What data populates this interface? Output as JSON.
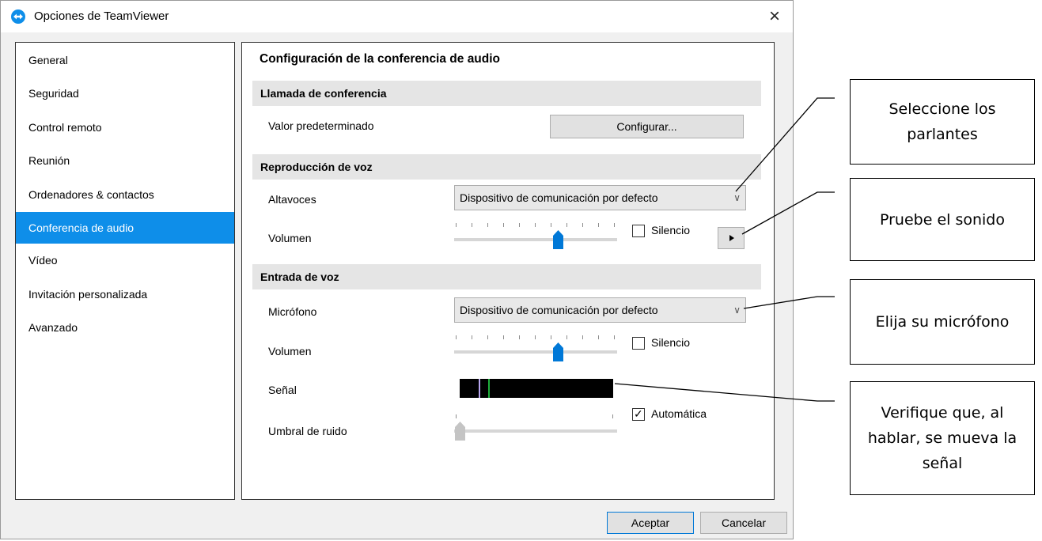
{
  "window": {
    "title": "Opciones de TeamViewer",
    "close_label": "×"
  },
  "nav": {
    "items": [
      {
        "label": "General"
      },
      {
        "label": "Seguridad"
      },
      {
        "label": "Control remoto"
      },
      {
        "label": "Reunión"
      },
      {
        "label": "Ordenadores & contactos"
      },
      {
        "label": "Conferencia de audio",
        "selected": true
      },
      {
        "label": "Vídeo"
      },
      {
        "label": "Invitación personalizada"
      },
      {
        "label": "Avanzado"
      }
    ]
  },
  "panel": {
    "title": "Configuración de la conferencia de audio",
    "conference_call": {
      "header": "Llamada de conferencia",
      "default_label": "Valor predeterminado",
      "configure_button": "Configurar..."
    },
    "voice_playback": {
      "header": "Reproducción de voz",
      "speakers_label": "Altavoces",
      "speakers_value": "Dispositivo de comunicación por defecto",
      "volume_label": "Volumen",
      "volume_level": 0.65,
      "mute_label": "Silencio",
      "mute_checked": false
    },
    "voice_input": {
      "header": "Entrada de voz",
      "mic_label": "Micrófono",
      "mic_value": "Dispositivo de comunicación por defecto",
      "volume_label": "Volumen",
      "volume_level": 0.65,
      "mute_label": "Silencio",
      "mute_checked": false,
      "signal_label": "Señal",
      "noise_label": "Umbral de ruido",
      "noise_level": 0.0,
      "auto_label": "Automática",
      "auto_checked": true
    }
  },
  "footer": {
    "ok_label": "Aceptar",
    "cancel_label": "Cancelar"
  },
  "callouts": {
    "speakers": "Seleccione los parlantes",
    "test_sound": "Pruebe el sonido",
    "microphone": "Elija su micrófono",
    "signal": "Verifique que, al hablar, se mueva la señal"
  },
  "colors": {
    "accent": "#0e8ee9",
    "thumb": "#0078d7",
    "signal_purple": "#b8a6f0",
    "signal_green": "#1fae3c"
  }
}
